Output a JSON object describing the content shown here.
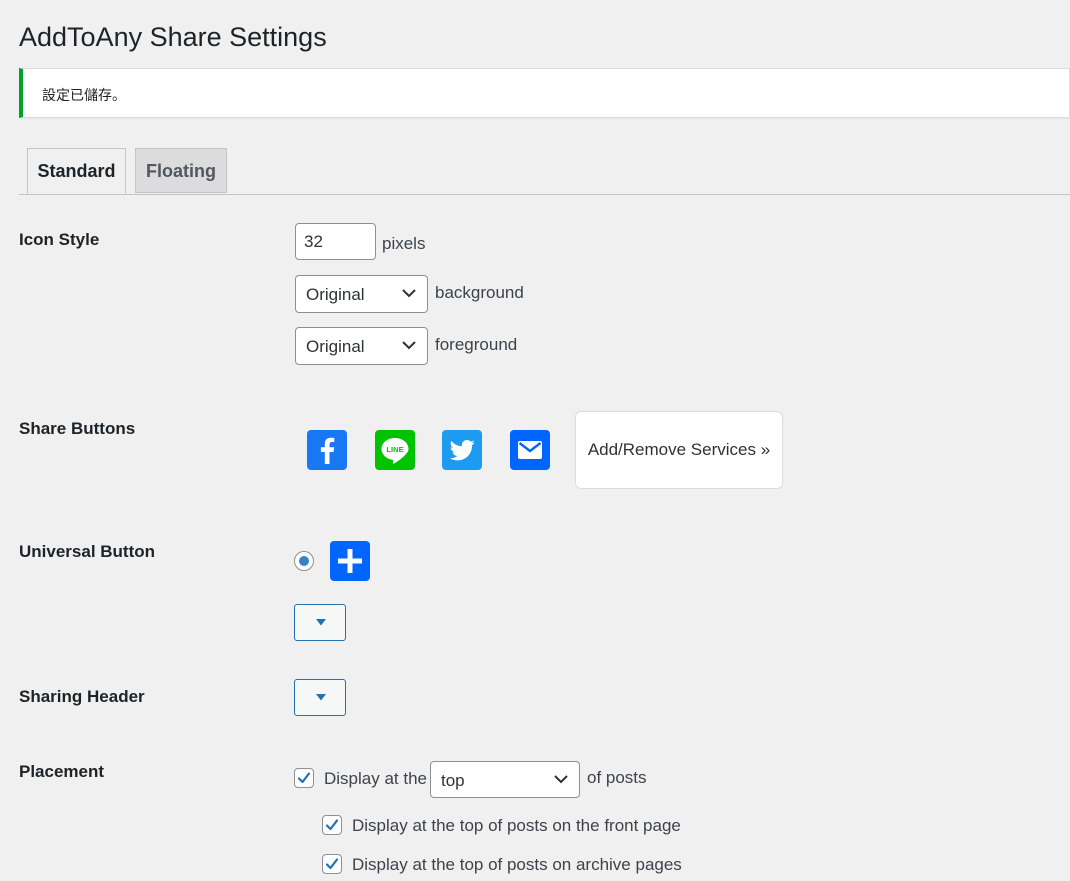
{
  "page": {
    "title": "AddToAny Share Settings",
    "notice": "設定已儲存。"
  },
  "tabs": [
    {
      "label": "Standard",
      "active": true
    },
    {
      "label": "Floating",
      "active": false
    }
  ],
  "icon_style": {
    "label": "Icon Style",
    "size_value": "32",
    "size_unit": "pixels",
    "background_select": "Original",
    "background_label": "background",
    "foreground_select": "Original",
    "foreground_label": "foreground"
  },
  "share_buttons": {
    "label": "Share Buttons",
    "services": [
      {
        "name": "facebook",
        "color": "#1877f2"
      },
      {
        "name": "line",
        "color": "#00c300"
      },
      {
        "name": "twitter",
        "color": "#1d9bf0"
      },
      {
        "name": "email",
        "color": "#0166ff"
      }
    ],
    "add_remove_label": "Add/Remove Services »"
  },
  "universal_button": {
    "label": "Universal Button",
    "selected": true,
    "color": "#0166ff"
  },
  "sharing_header": {
    "label": "Sharing Header"
  },
  "placement": {
    "label": "Placement",
    "display_prefix": "Display at the",
    "position_select": "top",
    "display_suffix": "of posts",
    "front_page": "Display at the top of posts on the front page",
    "archive_pages": "Display at the top of posts on archive pages"
  },
  "colors": {
    "notice_border": "#00a32a",
    "radio_accent": "#3582c4",
    "button_border": "#2271b1"
  }
}
